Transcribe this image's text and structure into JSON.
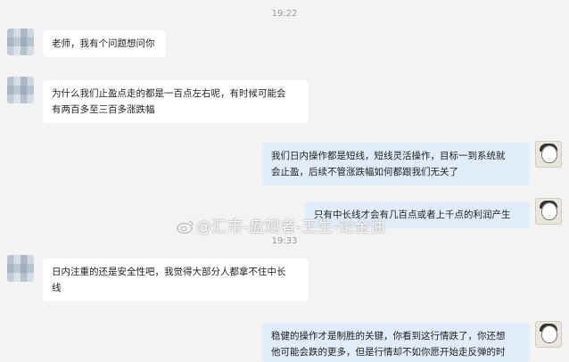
{
  "chat": {
    "time1": "19:22",
    "time2": "19:33",
    "messages": [
      {
        "side": "left",
        "text": "老师，我有个问题想问你"
      },
      {
        "side": "left",
        "text": "为什么我们止盈点走的都是一百点左右呢，有时候可能会\n有两百多至三百多涨跌幅"
      },
      {
        "side": "right",
        "text": "我们日内操作都是短线，短线灵活操作，目标一到系统就\n会止盈，后续不管涨跌幅如何都跟我们无关了"
      },
      {
        "side": "right",
        "text": "只有中长线才会有几百点或者上千点的利润产生"
      },
      {
        "side": "left",
        "text": "日内注重的还是安全性吧，我觉得大部分人都拿不住中长\n线"
      },
      {
        "side": "right",
        "text": "稳健的操作才是制胜的关键，你看到这行情跌了，你还想\n他可能会跌的更多，但是行情却不如你愿开始走反弹的时"
      }
    ]
  },
  "watermark": {
    "text": "@汇市-盘观者-王生-论金油"
  },
  "icons": {
    "left_avatar": "blurred-avatar-icon",
    "right_avatar": "user-avatar-icon",
    "weibo": "weibo-logo-icon"
  }
}
